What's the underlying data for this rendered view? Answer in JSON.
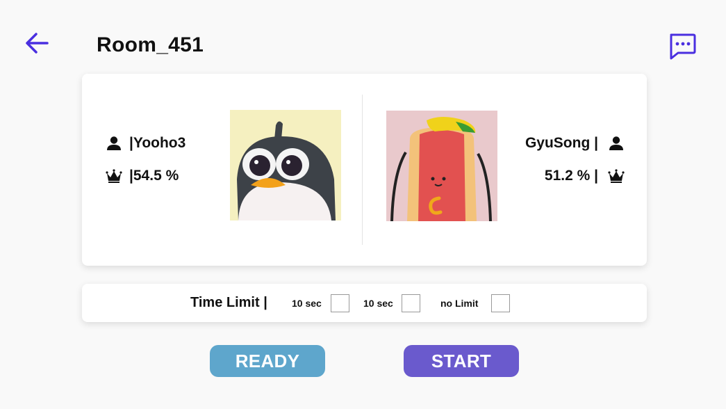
{
  "header": {
    "title": "Room_451",
    "back_icon": "arrow-left-icon",
    "chat_icon": "chat-bubble-dots-icon",
    "accent": "#4a2fe0"
  },
  "players": [
    {
      "name": "Yooho3",
      "name_text": "|Yooho3",
      "win_rate": "54.5 %",
      "win_rate_text": "|54.5 %",
      "avatar": "penguin",
      "avatar_bg": "#f5f0c0"
    },
    {
      "name": "GyuSong",
      "name_text": "GyuSong |",
      "win_rate": "51.2 %",
      "win_rate_text": "51.2 % |",
      "avatar": "hotdog",
      "avatar_bg": "#e9c9cc"
    }
  ],
  "time_limit": {
    "label": "Time Limit |",
    "options": [
      {
        "label": "10 sec",
        "checked": false
      },
      {
        "label": "10 sec",
        "checked": false
      },
      {
        "label": "no Limit",
        "checked": false
      }
    ]
  },
  "actions": {
    "ready_label": "READY",
    "ready_color": "#5ea6cc",
    "start_label": "START",
    "start_color": "#6a5acd"
  }
}
